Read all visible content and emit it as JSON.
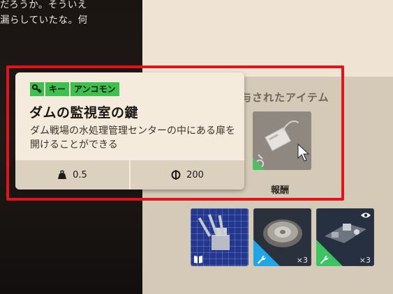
{
  "dialogue": {
    "lines": "だろうか。そういえ\n漏らしていたな。何"
  },
  "received_panel": {
    "title": "与されたアイテム",
    "reward_label": "報酬"
  },
  "tooltip": {
    "tags": [
      "キー",
      "アンコモン"
    ],
    "tag_icon": "key-icon",
    "title": "ダムの監視室の鍵",
    "description": "ダム戦場の水処理管理センターの中にある扉を開けることができる",
    "weight": "0.5",
    "value": "200"
  },
  "slots": [
    {
      "kind": "blueprint",
      "badge_icon": "book-icon",
      "quantity": ""
    },
    {
      "kind": "part",
      "badge_icon": "wrench-icon",
      "quantity": "×3",
      "rarity_color": "#1fa6e8"
    },
    {
      "kind": "part",
      "badge_icon": "wrench-icon",
      "quantity": "×3",
      "rarity_color": "#3cc463",
      "extra_icon": "eye-icon"
    }
  ],
  "colors": {
    "tag_green": "#3ec04f",
    "highlight_red": "#e3121b",
    "card_bg": "#f5ebdc",
    "panel_bg": "#d5c9b7"
  }
}
